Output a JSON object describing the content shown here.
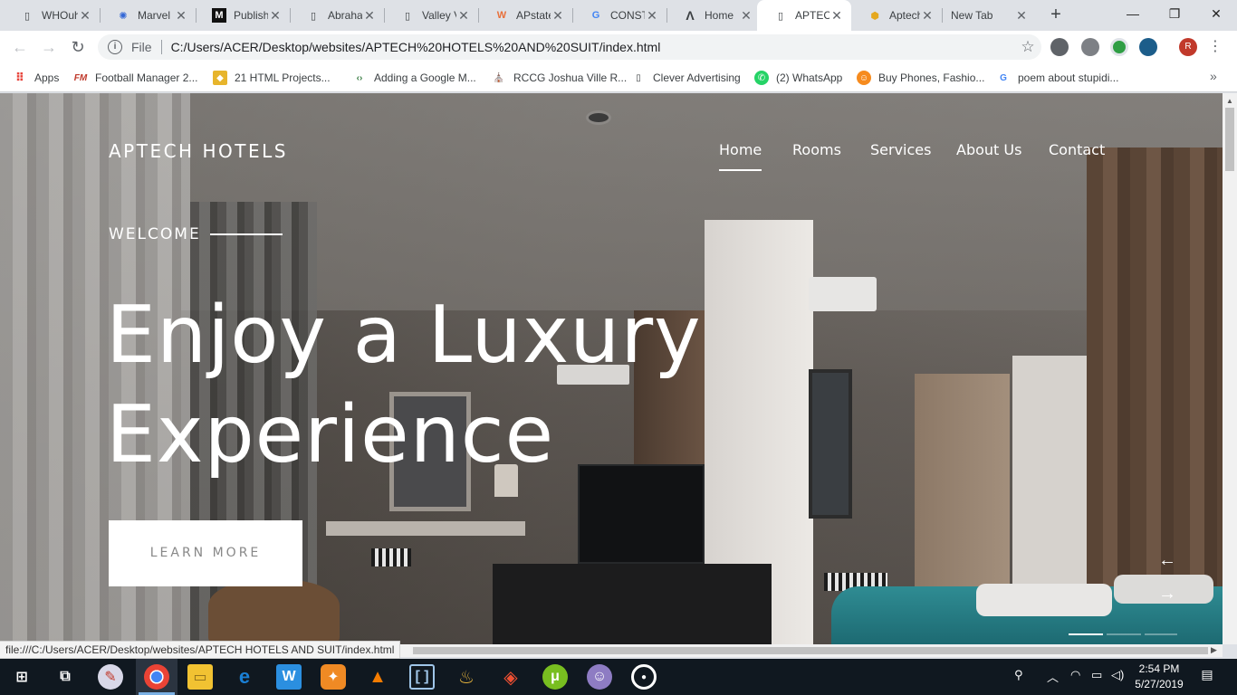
{
  "browser": {
    "tabs": [
      {
        "label": "WHOuh",
        "icon": "page-icon"
      },
      {
        "label": "Marvel",
        "icon": "marvel-icon"
      },
      {
        "label": "Publish",
        "icon": "medium-icon"
      },
      {
        "label": "Abraha",
        "icon": "page-icon"
      },
      {
        "label": "Valley V",
        "icon": "page-icon"
      },
      {
        "label": "APstate",
        "icon": "apstate-icon"
      },
      {
        "label": "CONST",
        "icon": "google-icon"
      },
      {
        "label": "Home",
        "icon": "a-logo-icon"
      },
      {
        "label": "APTECH",
        "icon": "page-icon"
      },
      {
        "label": "Aptech",
        "icon": "aptech-icon"
      },
      {
        "label": "New Tab",
        "icon": ""
      }
    ],
    "active_tab_index": 8,
    "close_glyph": "✕",
    "new_tab_glyph": "+",
    "window_controls": {
      "minimize": "—",
      "maximize": "❐",
      "close": "✕"
    },
    "address": {
      "scheme": "File",
      "url": "C:/Users/ACER/Desktop/websites/APTECH%20HOTELS%20AND%20SUIT/index.html"
    },
    "profile_initial": "R",
    "bookmarks": [
      {
        "label": "Apps",
        "icon": "apps-grid-icon"
      },
      {
        "label": "Football Manager 2...",
        "icon": "fm-icon"
      },
      {
        "label": "21 HTML Projects...",
        "icon": "html-icon"
      },
      {
        "label": "Adding a Google M...",
        "icon": "code-icon"
      },
      {
        "label": "RCCG Joshua Ville R...",
        "icon": "church-icon"
      },
      {
        "label": "Clever Advertising",
        "icon": "page-icon"
      },
      {
        "label": "(2) WhatsApp",
        "icon": "whatsapp-icon"
      },
      {
        "label": "Buy Phones, Fashio...",
        "icon": "jumia-icon"
      },
      {
        "label": "poem about stupidi...",
        "icon": "google-icon"
      }
    ],
    "bookmarks_more": "»",
    "status_url": "file:///C:/Users/ACER/Desktop/websites/APTECH HOTELS AND SUIT/index.html"
  },
  "site": {
    "logo": "APTECH HOTELS",
    "nav": [
      {
        "label": "Home",
        "active": true
      },
      {
        "label": "Rooms",
        "active": false
      },
      {
        "label": "Services",
        "active": false
      },
      {
        "label": "About Us",
        "active": false
      },
      {
        "label": "Contact",
        "active": false
      }
    ],
    "welcome": "WELCOME",
    "headline_line1": "Enjoy a Luxury",
    "headline_line2": "Experience",
    "cta": "LEARN MORE",
    "prev_arrow": "←",
    "next_arrow": "→"
  },
  "taskbar": {
    "apps": [
      "start-icon",
      "task-view-icon",
      "paint-icon",
      "chrome-icon",
      "file-explorer-icon",
      "edge-icon",
      "wps-writer-icon",
      "uc-browser-icon",
      "vlc-icon",
      "brackets-icon",
      "aladdin-lamp-icon",
      "git-icon",
      "utorrent-icon",
      "github-desktop-icon",
      "ring-icon"
    ],
    "time": "2:54 PM",
    "date": "5/27/2019"
  },
  "colors": {
    "chrome_tabstrip": "#dee1e6",
    "taskbar": "#101820",
    "hero_text": "#ffffff",
    "cta_bg": "#ffffff",
    "cta_text": "#888888",
    "bed_teal": "#2f8c93"
  }
}
